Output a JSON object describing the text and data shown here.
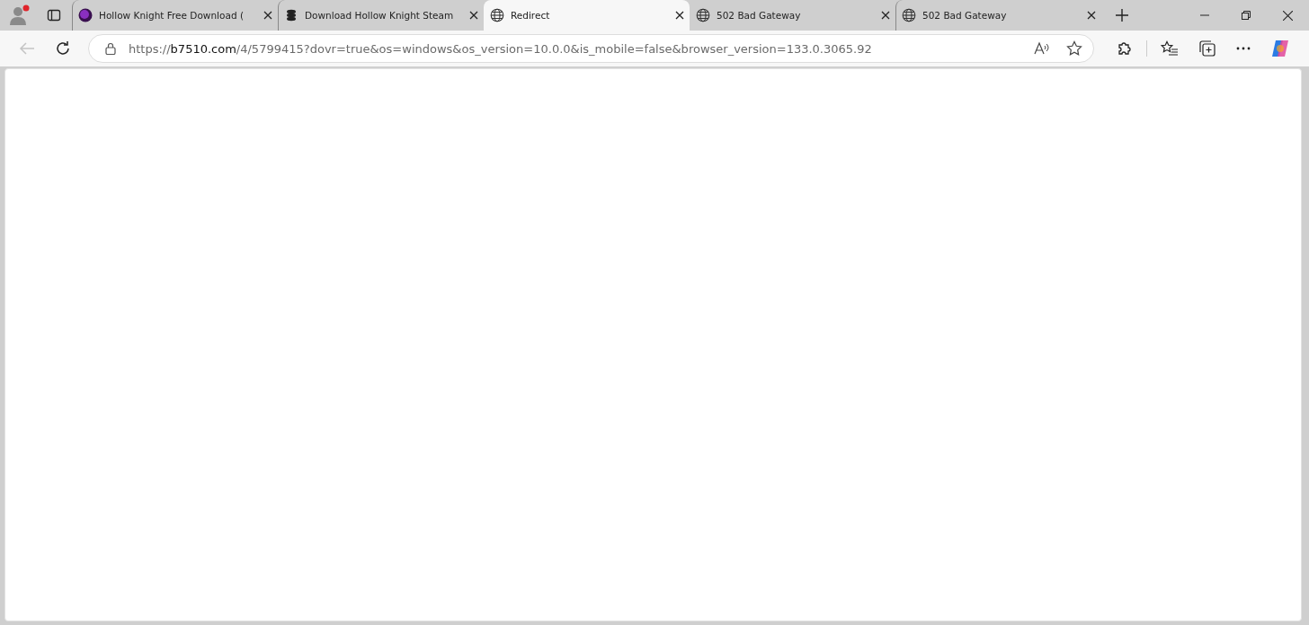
{
  "tabs": [
    {
      "title": "Hollow Knight Free Download (",
      "kind": "orb",
      "selected": false
    },
    {
      "title": "Download Hollow Knight Steam",
      "kind": "stack",
      "selected": false
    },
    {
      "title": "Redirect",
      "kind": "globe",
      "selected": true
    },
    {
      "title": "502 Bad Gateway",
      "kind": "globe",
      "selected": false
    },
    {
      "title": "502 Bad Gateway",
      "kind": "globe",
      "selected": false
    }
  ],
  "address_bar": {
    "scheme": "https://",
    "host": "b7510.com",
    "path": "/4/5799415?dovr=true&os=windows&os_version=10.0.0&is_mobile=false&browser_version=133.0.3065.92"
  },
  "back_disabled": true
}
